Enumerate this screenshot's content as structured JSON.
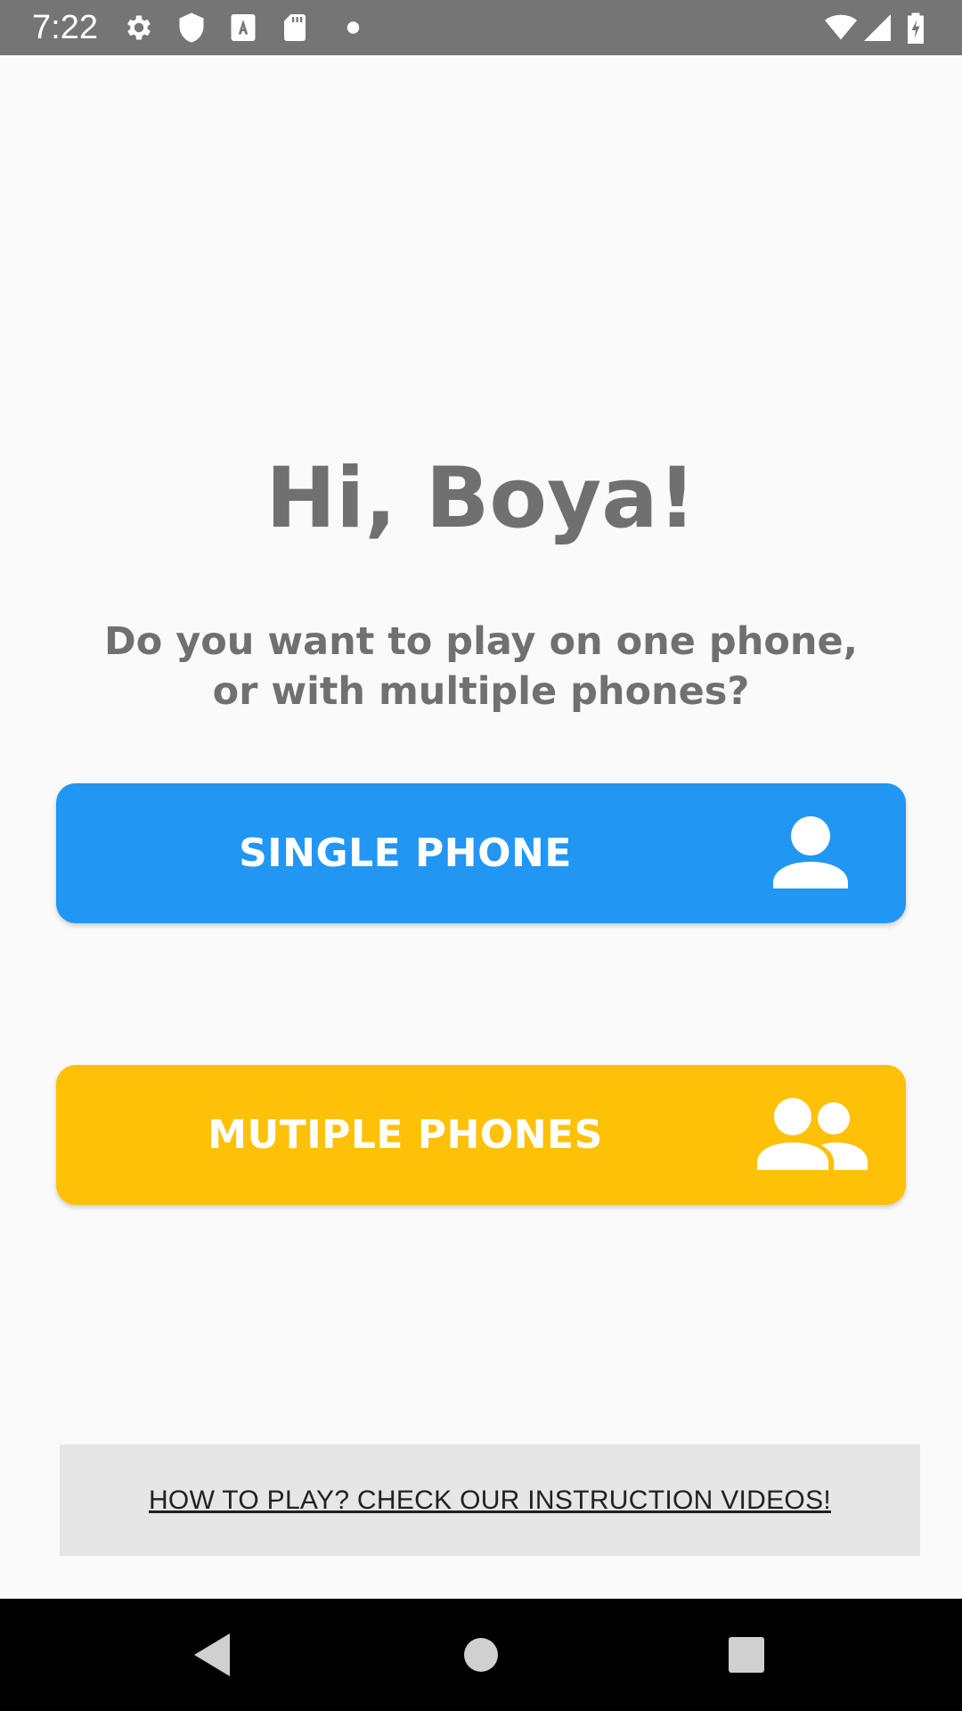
{
  "status_bar": {
    "time": "7:22",
    "icons": [
      "gear-icon",
      "shield-icon",
      "keyboard-a-icon",
      "sd-card-icon",
      "dot-icon",
      "wifi-icon",
      "signal-icon",
      "battery-charging-icon"
    ]
  },
  "main": {
    "greeting": "Hi, Boya!",
    "question": "Do you want to play on one phone, or with multiple phones?",
    "single_button": {
      "label": "SINGLE PHONE",
      "icon": "person-icon",
      "color": "#2196f3"
    },
    "multi_button": {
      "label": "MUTIPLE PHONES",
      "icon": "people-icon",
      "color": "#ffc107"
    },
    "instructions_link": "HOW TO PLAY? CHECK OUR INSTRUCTION VIDEOS!"
  },
  "nav_bar": {
    "buttons": [
      "back-icon",
      "home-icon",
      "recents-icon"
    ]
  }
}
